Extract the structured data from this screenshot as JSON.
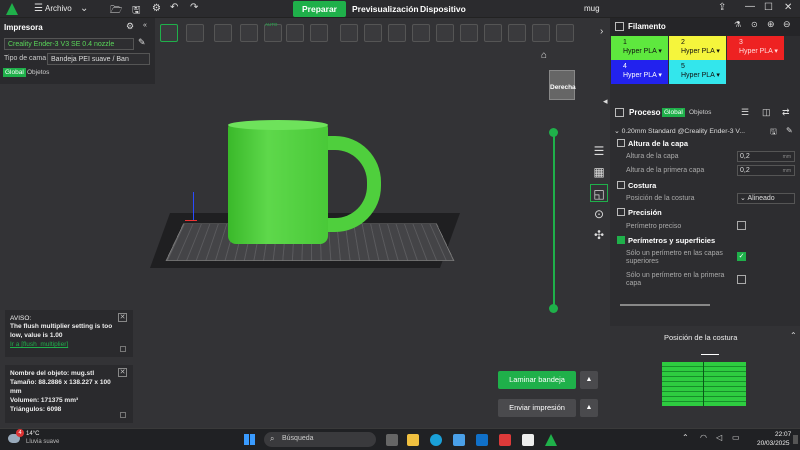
{
  "menu": {
    "file_label": "Archivo"
  },
  "tabs": {
    "prepare": "Preparar",
    "preview": "Previsualización",
    "device": "Dispositivo"
  },
  "window": {
    "title": "mug"
  },
  "left_panel": {
    "printer_title": "Impresora",
    "printer_value": "Creality Ender-3 V3 SE 0.4 nozzle",
    "bed_label": "Tipo de cama",
    "bed_value": "Bandeja PEI suave / Ban",
    "tab_global": "Global",
    "tab_objects": "Objetos"
  },
  "toolbar": {
    "auto_label": "AUTO"
  },
  "viewport": {
    "view_label": "Derecha"
  },
  "notice": {
    "title": "AVISO:",
    "message": "The flush multiplier setting is too low, value is 1.00",
    "link": "Ir a [flush_multiplier]"
  },
  "object_info": {
    "name": "Nombre del objeto: mug.stl",
    "size": "Tamaño: 88.2886 x 138.227 x 100 mm",
    "volume": "Volumen: 171375 mm³",
    "triangles": "Triángulos: 6098"
  },
  "actions": {
    "slice": "Laminar bandeja",
    "send": "Enviar impresión"
  },
  "filament": {
    "title": "Filamento",
    "slots": [
      {
        "num": "1",
        "name": "Hyper PLA",
        "color": "#5ee83e"
      },
      {
        "num": "2",
        "name": "Hyper PLA",
        "color": "#f5f53c"
      },
      {
        "num": "3",
        "name": "Hyper PLA",
        "color": "#ee2222"
      },
      {
        "num": "4",
        "name": "Hyper PLA",
        "color": "#2222ee"
      },
      {
        "num": "5",
        "name": "Hyper PLA",
        "color": "#33e6ec"
      }
    ]
  },
  "process": {
    "title": "Proceso",
    "tab_global": "Global",
    "tab_objects": "Objetos",
    "preset": "0.20mm Standard @Creality Ender-3 V..."
  },
  "settings": {
    "layer_height_title": "Altura de la capa",
    "layer_height_label": "Altura de la capa",
    "layer_height_value": "0,2",
    "first_layer_label": "Altura de la primera capa",
    "first_layer_value": "0,2",
    "unit_mm": "mm",
    "seam_title": "Costura",
    "seam_position_label": "Posición de la costura",
    "seam_position_value": "Alineado",
    "precision_title": "Precisión",
    "precise_wall_label": "Perímetro preciso",
    "walls_title": "Perímetros y superficies",
    "single_top_label": "Sólo un perímetro en las capas superiores",
    "single_first_label": "Sólo un perímetro en la primera capa"
  },
  "seam_preview": {
    "title": "Posición de la costura"
  },
  "taskbar": {
    "temp": "14°C",
    "weather": "Lluvia suave",
    "badge": "4",
    "search_placeholder": "Búsqueda",
    "time": "22:07",
    "date": "20/03/2025"
  },
  "colors": {
    "accent": "#1fb04a"
  }
}
